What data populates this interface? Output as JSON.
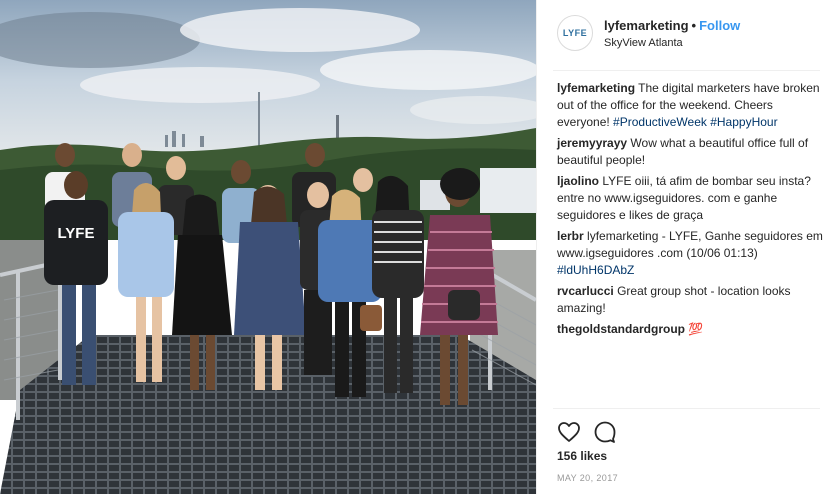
{
  "post": {
    "username": "lyfemarketing",
    "follow_label": "Follow",
    "location": "SkyView Atlanta",
    "avatar_text": "LYFE",
    "shirt_text": "LYFE",
    "caption_parts": [
      "The digital marketers have broken out of the office for the weekend. Cheers everyone! ",
      "#ProductiveWeek",
      " ",
      "#HappyHour"
    ],
    "comments": [
      {
        "user": "jeremyyrayy",
        "parts": [
          "Wow what a beautiful office full of beautiful people!"
        ]
      },
      {
        "user": "ljaolino",
        "parts": [
          "LYFE oiii, tá afim de bombar seu insta? entre no www.igseguidores. com e ganhe seguidores e likes de graça"
        ]
      },
      {
        "user": "lerbr",
        "parts": [
          "lyfemarketing - LYFE, Ganhe seguidores em www.igseguidores .com (10/06 01:13) ",
          "#ldUhH6DAbZ"
        ]
      },
      {
        "user": "rvcarlucci",
        "parts": [
          "Great group shot - location looks amazing!"
        ]
      },
      {
        "user": "thegoldstandardgroup",
        "parts": [
          "💯"
        ]
      }
    ],
    "likes": "156 likes",
    "date": "MAY 20, 2017",
    "icons": [
      "heart-icon",
      "comment-icon"
    ]
  },
  "colors": {
    "link": "#3897f0",
    "hashtag": "#003569",
    "text": "#262626",
    "muted": "#999999"
  }
}
